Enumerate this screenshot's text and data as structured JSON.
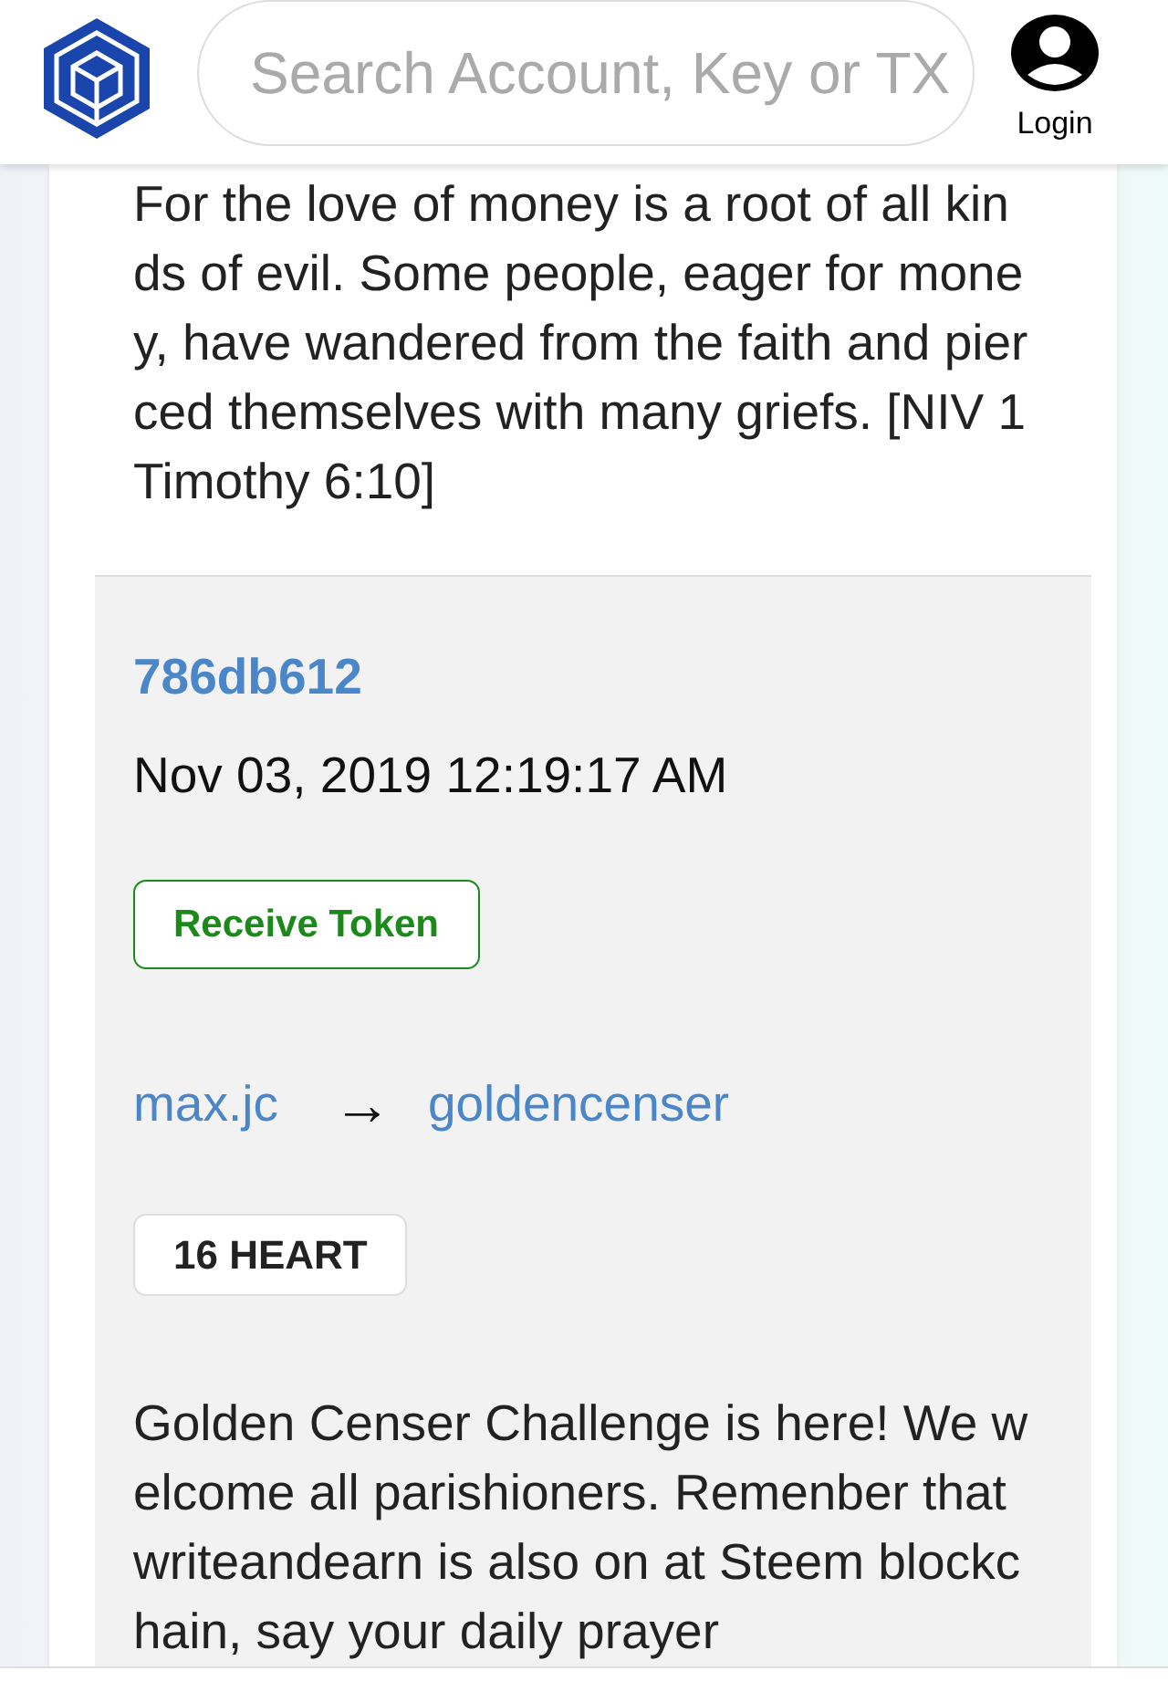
{
  "header": {
    "search": {
      "placeholder": "Search Account, Key or TX"
    },
    "login": {
      "label": "Login"
    }
  },
  "memo_above": "For the love of money is a root of all kinds of evil. Some people, eager for money, have wandered from the faith and pierced themselves with many griefs. [NIV 1 Timothy 6:10]",
  "transaction": {
    "id": "786db612",
    "time": "Nov 03, 2019 12:19:17 AM",
    "type": "Receive Token",
    "from": "max.jc",
    "arrow": "→",
    "to": "goldencenser",
    "amount": "16 HEART",
    "memo": "Golden Censer Challenge is here! We welcome all parishioners. Remenber that writeandearn is also on at Steem blockchain, say your daily prayer"
  }
}
